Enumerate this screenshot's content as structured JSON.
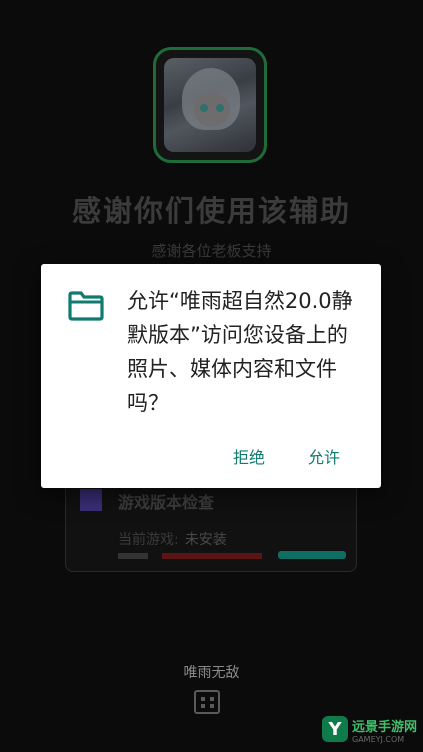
{
  "app": {
    "title": "感谢你们使用该辅助",
    "subtitle": "感谢各位老板支持"
  },
  "card": {
    "title": "游戏版本检查",
    "current_game_label": "当前游戏:",
    "current_game_value": "未安装"
  },
  "footer": {
    "text": "唯雨无敌"
  },
  "dialog": {
    "message": "允许“唯雨超自然20.0静默版本”访问您设备上的照片、媒体内容和文件吗？",
    "deny_label": "拒绝",
    "allow_label": "允许"
  },
  "watermark": {
    "brand": "远景手游网",
    "url": "GAMEYJ.COM"
  },
  "colors": {
    "accent": "#0f7a6e",
    "background": "#0b0b0b",
    "dialog_bg": "#ffffff"
  }
}
